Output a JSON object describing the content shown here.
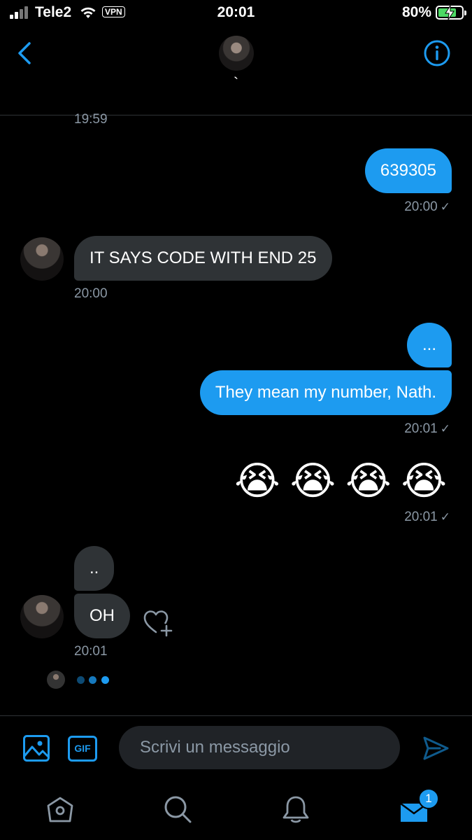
{
  "status_bar": {
    "carrier": "Tele2",
    "vpn": "VPN",
    "time": "20:01",
    "battery": "80%",
    "battery_level": 0.8
  },
  "header": {
    "contact_name": "`"
  },
  "messages": {
    "top_time": "19:59",
    "m1": {
      "text": "639305",
      "time": "20:00",
      "status": "✓"
    },
    "m2": {
      "text": "IT SAYS CODE WITH END 25",
      "time": "20:00"
    },
    "m3": {
      "text": "..."
    },
    "m4": {
      "text": "They mean my number, Nath.",
      "time": "20:01",
      "status": "✓"
    },
    "m5": {
      "text": "😭😭😭😭",
      "time": "20:01",
      "status": "✓"
    },
    "m6": {
      "text": ".."
    },
    "m7": {
      "text": "OH",
      "time": "20:01"
    }
  },
  "composer": {
    "gif_label": "GIF",
    "placeholder": "Scrivi un messaggio"
  },
  "tabbar": {
    "messages_badge": "1"
  },
  "colors": {
    "accent": "#1d9bf0",
    "received_bubble": "#2f3336",
    "background": "#000000",
    "muted_text": "#8b98a5"
  },
  "icons": [
    "back-arrow-icon",
    "info-icon",
    "heart-plus-icon",
    "image-icon",
    "gif-icon",
    "send-icon",
    "home-icon",
    "search-icon",
    "bell-icon",
    "mail-icon"
  ]
}
